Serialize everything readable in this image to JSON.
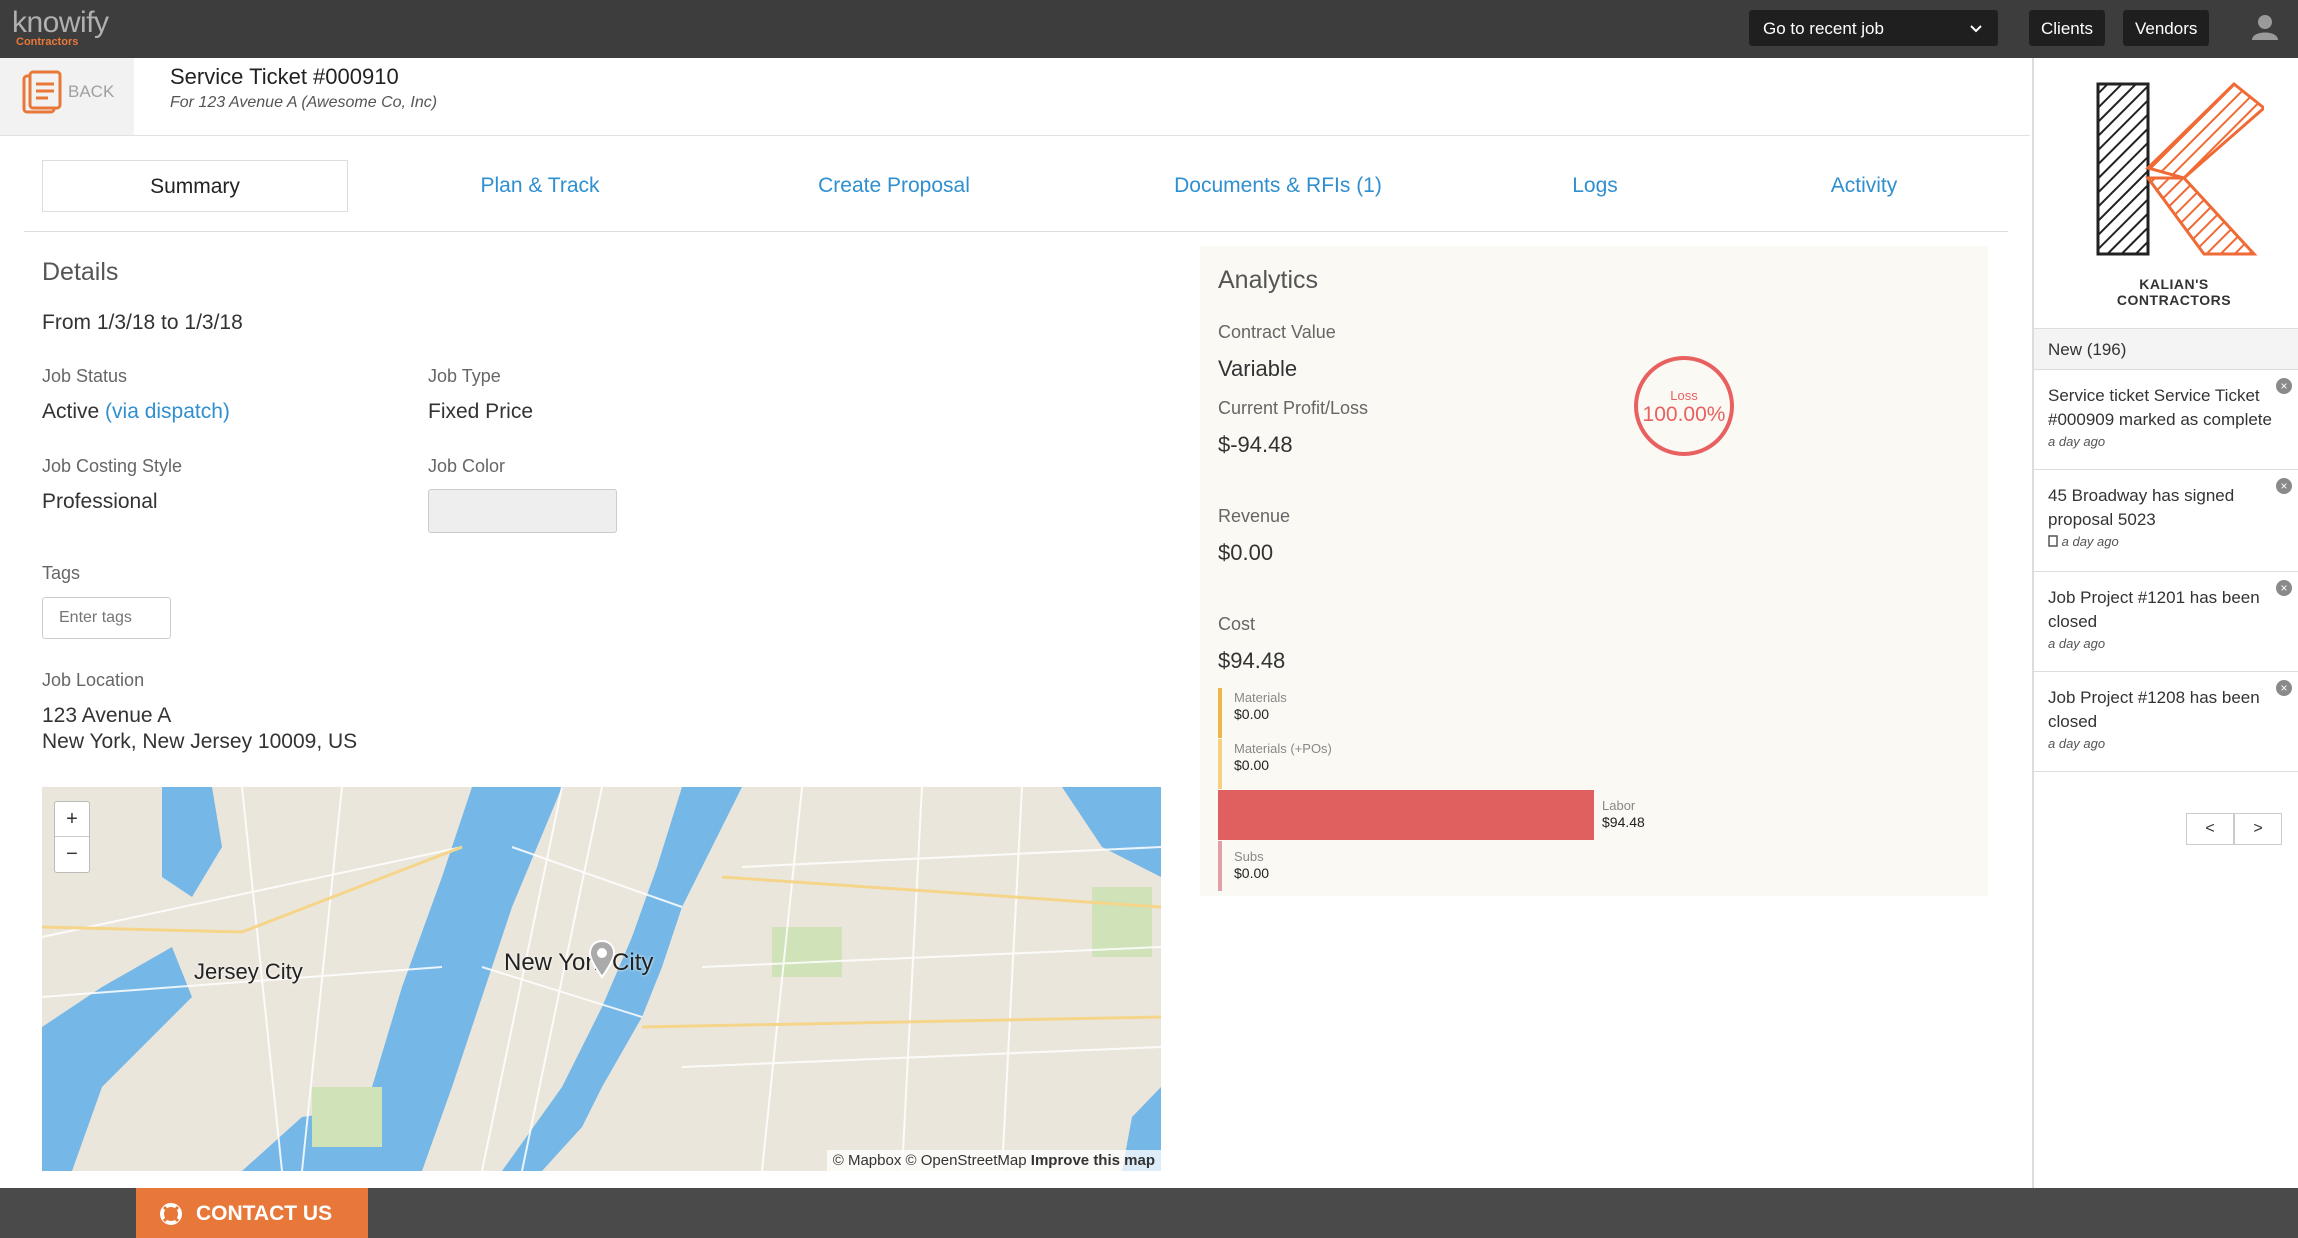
{
  "topbar": {
    "logo_text": "knowify",
    "logo_sub": "Contractors",
    "recent_job_label": "Go to recent job",
    "clients_label": "Clients",
    "vendors_label": "Vendors"
  },
  "header": {
    "back_label": "BACK",
    "title": "Service Ticket #000910",
    "subtitle": "For 123 Avenue A (Awesome Co, Inc)"
  },
  "tabs": [
    {
      "label": "Summary"
    },
    {
      "label": "Plan & Track"
    },
    {
      "label": "Create Proposal"
    },
    {
      "label": "Documents & RFIs (1)"
    },
    {
      "label": "Logs"
    },
    {
      "label": "Activity"
    }
  ],
  "details": {
    "heading": "Details",
    "date_range": "From 1/3/18 to 1/3/18",
    "job_status_label": "Job Status",
    "job_status_value": "Active",
    "job_status_link": "(via dispatch)",
    "job_type_label": "Job Type",
    "job_type_value": "Fixed Price",
    "costing_label": "Job Costing Style",
    "costing_value": "Professional",
    "color_label": "Job Color",
    "tags_label": "Tags",
    "tags_placeholder": "Enter tags",
    "location_label": "Job Location",
    "address_line1": "123 Avenue A",
    "address_line2": "New York, New Jersey 10009, US"
  },
  "map": {
    "zoom_in": "+",
    "zoom_out": "−",
    "label_jersey": "Jersey City",
    "label_nyc": "New York City",
    "attribution": "© Mapbox © OpenStreetMap",
    "improve": "Improve this map"
  },
  "analytics": {
    "heading": "Analytics",
    "contract_label": "Contract Value",
    "contract_value": "Variable",
    "profit_label": "Current Profit/Loss",
    "profit_value": "$-94.48",
    "ring_label": "Loss",
    "ring_value": "100.00%",
    "revenue_label": "Revenue",
    "revenue_value": "$0.00",
    "cost_label": "Cost",
    "cost_value": "$94.48",
    "breakdown": [
      {
        "label": "Materials",
        "value": "$0.00",
        "color": "#f0b54a"
      },
      {
        "label": "Materials (+POs)",
        "value": "$0.00",
        "color": "#f5cf86"
      },
      {
        "label": "Labor",
        "value": "$94.48",
        "color": "#e06060",
        "fraction": 1.0
      },
      {
        "label": "Subs",
        "value": "$0.00",
        "color": "#e0a0a8"
      }
    ]
  },
  "sidebar": {
    "brand_text": "KALIAN'S CONTRACTORS",
    "new_label": "New (196)",
    "notifications": [
      {
        "text": "Service ticket Service Ticket #000909 marked as complete",
        "when": "a day ago"
      },
      {
        "text": "45 Broadway has signed proposal 5023",
        "when": "a day ago"
      },
      {
        "text": "Job Project #1201 has been closed",
        "when": "a day ago"
      },
      {
        "text": "Job Project #1208 has been closed",
        "when": "a day ago"
      }
    ],
    "prev": "<",
    "next": ">"
  },
  "footer": {
    "contact_label": "CONTACT US"
  }
}
